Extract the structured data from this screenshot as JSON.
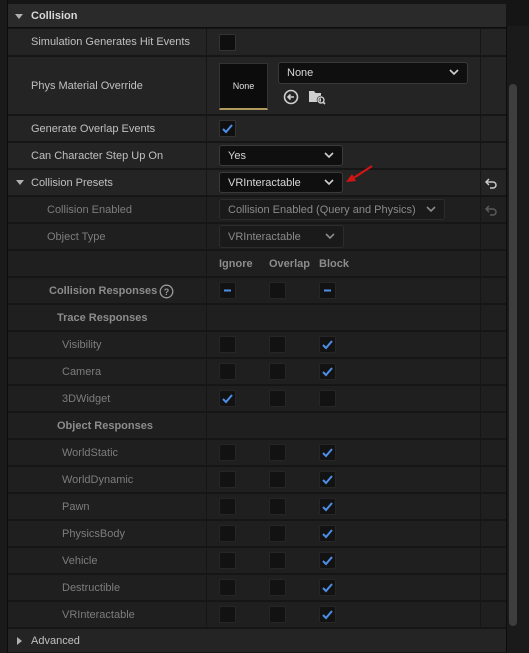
{
  "section": {
    "title": "Collision"
  },
  "props": {
    "simulation_hit_events": {
      "label": "Simulation Generates Hit Events",
      "checked": false
    },
    "phys_material": {
      "label": "Phys Material Override",
      "thumb_text": "None",
      "value": "None"
    },
    "overlap_events": {
      "label": "Generate Overlap Events",
      "checked": true
    },
    "step_up": {
      "label": "Can Character Step Up On",
      "value": "Yes"
    },
    "presets": {
      "label": "Collision Presets",
      "value": "VRInteractable"
    },
    "collision_enabled": {
      "label": "Collision Enabled",
      "value": "Collision Enabled (Query and Physics)"
    },
    "object_type": {
      "label": "Object Type",
      "value": "VRInteractable"
    }
  },
  "response_headers": {
    "ignore": "Ignore",
    "overlap": "Overlap",
    "block": "Block"
  },
  "collision_responses": {
    "label": "Collision Responses",
    "help": "?"
  },
  "trace_responses": {
    "label": "Trace Responses",
    "rows": [
      {
        "name": "Visibility",
        "state": "block"
      },
      {
        "name": "Camera",
        "state": "block"
      },
      {
        "name": "3DWidget",
        "state": "ignore"
      }
    ]
  },
  "object_responses": {
    "label": "Object Responses",
    "rows": [
      {
        "name": "WorldStatic",
        "state": "block"
      },
      {
        "name": "WorldDynamic",
        "state": "block"
      },
      {
        "name": "Pawn",
        "state": "block"
      },
      {
        "name": "PhysicsBody",
        "state": "block"
      },
      {
        "name": "Vehicle",
        "state": "block"
      },
      {
        "name": "Destructible",
        "state": "block"
      },
      {
        "name": "VRInteractable",
        "state": "block"
      }
    ]
  },
  "advanced": {
    "label": "Advanced"
  },
  "colors": {
    "accent_check": "#4d8fe8",
    "annotation_arrow": "#d11414",
    "thumb_underline": "#b09a5c"
  }
}
